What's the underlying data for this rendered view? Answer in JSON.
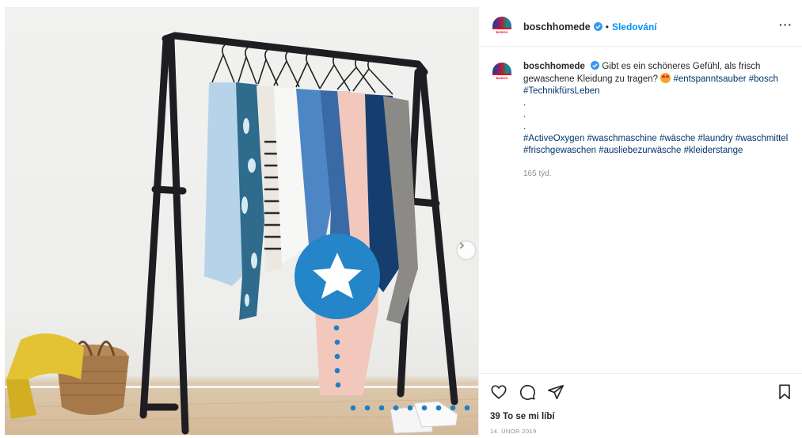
{
  "post": {
    "username": "boschhomede",
    "avatar_text": "BOSCH",
    "dot": "•",
    "follow_label": "Sledování",
    "more_label": "···",
    "verified_icon": "verified-badge-icon"
  },
  "caption": {
    "username": "boschhomede",
    "text_1": "Gibt es ein schöneres Gefühl, als frisch gewaschene Kleidung zu tragen?",
    "emoji": "heart-eyes-emoji",
    "hashtags_1": "#entspanntsauber #bosch #TechnikfürsLeben",
    "dot_1": ".",
    "dot_2": ".",
    "dot_3": ".",
    "hashtags_2": "#ActiveOxygen #waschmaschine #wäsche #laundry #waschmittel #frischgewaschen #ausliebezurwäsche #kleiderstange",
    "time": "165 týd."
  },
  "footer": {
    "likes": "39 To se mi líbí",
    "date": "14. ÚNOR 2019"
  },
  "colors": {
    "accent": "#0095f6",
    "hashtag": "#00376b",
    "star_circle": "#1f7fc4"
  }
}
